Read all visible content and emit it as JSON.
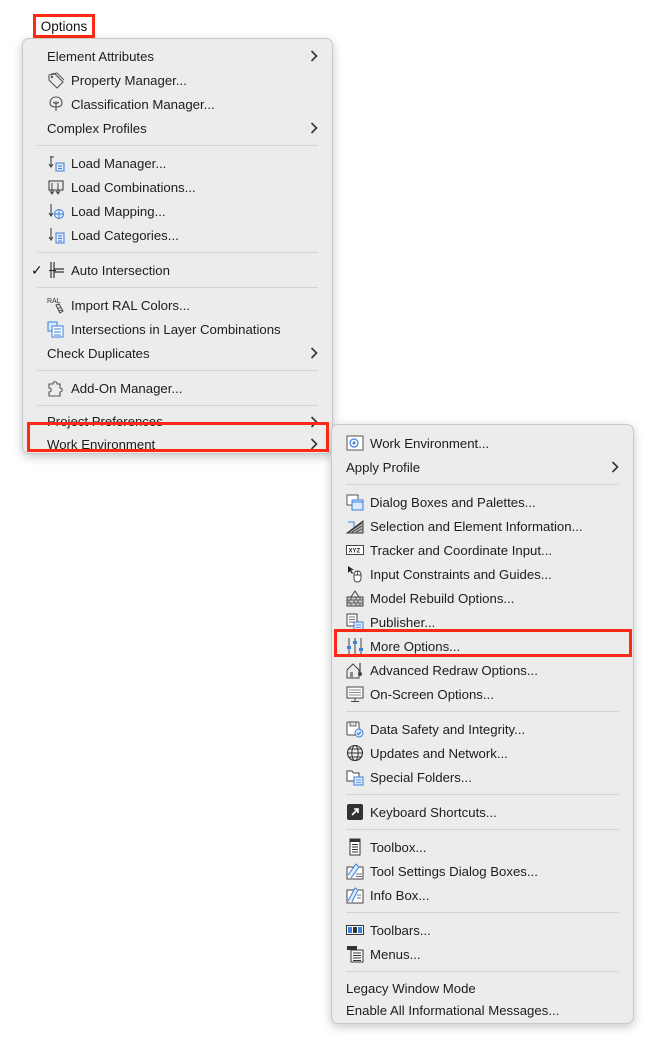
{
  "menu_bar": {
    "title": "Options"
  },
  "options_menu": {
    "items": [
      {
        "label": "Element Attributes"
      },
      {
        "label": "Property Manager..."
      },
      {
        "label": "Classification Manager..."
      },
      {
        "label": "Complex Profiles"
      },
      {
        "label": "Load Manager..."
      },
      {
        "label": "Load Combinations..."
      },
      {
        "label": "Load Mapping..."
      },
      {
        "label": "Load Categories..."
      },
      {
        "label": "Auto Intersection",
        "check": "✓"
      },
      {
        "label": "Import RAL Colors...",
        "icon_text": "RAL"
      },
      {
        "label": "Intersections in Layer Combinations"
      },
      {
        "label": "Check Duplicates"
      },
      {
        "label": "Add-On Manager..."
      },
      {
        "label": "Project Preferences"
      },
      {
        "label": "Work Environment"
      }
    ]
  },
  "work_env_menu": {
    "items": [
      {
        "label": "Work Environment..."
      },
      {
        "label": "Apply Profile"
      },
      {
        "label": "Dialog Boxes and Palettes..."
      },
      {
        "label": "Selection and Element Information..."
      },
      {
        "label": "Tracker and Coordinate Input...",
        "icon_text": "XYZ"
      },
      {
        "label": "Input Constraints and Guides..."
      },
      {
        "label": "Model Rebuild Options..."
      },
      {
        "label": "Publisher..."
      },
      {
        "label": "More Options..."
      },
      {
        "label": "Advanced Redraw Options..."
      },
      {
        "label": "On-Screen Options..."
      },
      {
        "label": "Data Safety and Integrity..."
      },
      {
        "label": "Updates and Network..."
      },
      {
        "label": "Special Folders..."
      },
      {
        "label": "Keyboard Shortcuts..."
      },
      {
        "label": "Toolbox..."
      },
      {
        "label": "Tool Settings Dialog Boxes..."
      },
      {
        "label": "Info Box..."
      },
      {
        "label": "Toolbars..."
      },
      {
        "label": "Menus..."
      },
      {
        "label": "Legacy Window Mode"
      },
      {
        "label": "Enable All Informational Messages..."
      }
    ]
  },
  "colors": {
    "highlight": "#ff2a14",
    "menu_bg": "#ececec",
    "icon_blue": "#3d7fd9"
  }
}
